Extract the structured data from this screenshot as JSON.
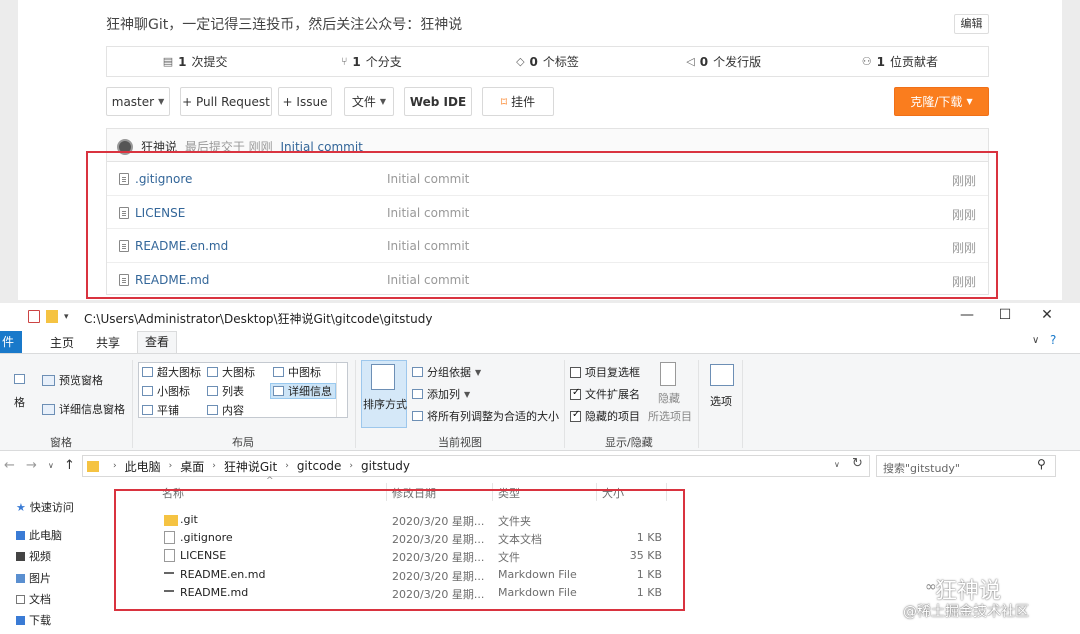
{
  "repo": {
    "description": "狂神聊Git，一定记得三连投币，然后关注公众号：狂神说",
    "edit_label": "编辑",
    "stats": [
      {
        "icon": "commit-icon",
        "count": "1",
        "label": "次提交"
      },
      {
        "icon": "branch-icon",
        "count": "1",
        "label": "个分支"
      },
      {
        "icon": "tag-icon",
        "count": "0",
        "label": "个标签"
      },
      {
        "icon": "release-icon",
        "count": "0",
        "label": "个发行版"
      },
      {
        "icon": "contributor-icon",
        "count": "1",
        "label": "位贡献者"
      }
    ],
    "toolbar": {
      "branch": "master",
      "pull_request": "+ Pull Request",
      "issue": "+ Issue",
      "file": "文件",
      "web_ide": "Web IDE",
      "star": "挂件",
      "clone": "克隆/下载"
    },
    "last_commit": {
      "author": "狂神说",
      "meta": "最后提交于 刚刚",
      "message": "Initial commit"
    },
    "files": [
      {
        "name": ".gitignore",
        "message": "Initial commit",
        "time": "刚刚"
      },
      {
        "name": "LICENSE",
        "message": "Initial commit",
        "time": "刚刚"
      },
      {
        "name": "README.en.md",
        "message": "Initial commit",
        "time": "刚刚"
      },
      {
        "name": "README.md",
        "message": "Initial commit",
        "time": "刚刚"
      }
    ]
  },
  "explorer": {
    "title_path": "C:\\Users\\Administrator\\Desktop\\狂神说Git\\gitcode\\gitstudy",
    "qa_arrow": "▾",
    "win_controls": {
      "minimize": "—",
      "maximize": "☐",
      "close": "✕"
    },
    "ribbon_tabs": {
      "file": "件",
      "home": "主页",
      "share": "共享",
      "view": "查看"
    },
    "ribbon_collapse": "∨",
    "help": "?",
    "ribbon": {
      "pane": {
        "preview": "预览窗格",
        "details": "详细信息窗格",
        "nav_partial": "格",
        "label": "窗格"
      },
      "layout": {
        "xl_icons": "超大图标",
        "l_icons": "大图标",
        "m_icons": "中图标",
        "s_icons": "小图标",
        "list": "列表",
        "details": "详细信息",
        "tiles": "平铺",
        "content": "内容",
        "label": "布局"
      },
      "current_view": {
        "sort": "排序方式",
        "group": "分组依据",
        "add_col": "添加列",
        "fit_cols": "将所有列调整为合适的大小",
        "label": "当前视图"
      },
      "show_hide": {
        "item_checkbox": "项目复选框",
        "file_ext": "文件扩展名",
        "hidden_items": "隐藏的项目",
        "hide": "隐藏",
        "hide_selected": "所选项目",
        "label": "显示/隐藏"
      },
      "options": "选项"
    },
    "nav": {
      "back": "←",
      "forward": "→",
      "recent": "∨",
      "up": "↑"
    },
    "breadcrumb": [
      "此电脑",
      "桌面",
      "狂神说Git",
      "gitcode",
      "gitstudy"
    ],
    "address_dropdown": "∨",
    "refresh": "↻",
    "search_placeholder": "搜索\"gitstudy\"",
    "search_icon": "⚲",
    "nav_pane": [
      {
        "icon": "star-icon",
        "label": "快速访问"
      },
      {
        "icon": "computer-icon",
        "label": "此电脑"
      },
      {
        "icon": "video-icon",
        "label": "视频"
      },
      {
        "icon": "picture-icon",
        "label": "图片"
      },
      {
        "icon": "document-icon",
        "label": "文档"
      },
      {
        "icon": "download-icon",
        "label": "下载"
      }
    ],
    "columns": {
      "name": "名称",
      "date": "修改日期",
      "type": "类型",
      "size": "大小"
    },
    "sort_caret": "^",
    "rows": [
      {
        "icon": "folder-icon",
        "name": ".git",
        "date": "2020/3/20 星期...",
        "type": "文件夹",
        "size": ""
      },
      {
        "icon": "text-file-icon",
        "name": ".gitignore",
        "date": "2020/3/20 星期...",
        "type": "文本文档",
        "size": "1 KB"
      },
      {
        "icon": "file-icon",
        "name": "LICENSE",
        "date": "2020/3/20 星期...",
        "type": "文件",
        "size": "35 KB"
      },
      {
        "icon": "markdown-file-icon",
        "name": "README.en.md",
        "date": "2020/3/20 星期...",
        "type": "Markdown File",
        "size": "1 KB"
      },
      {
        "icon": "markdown-file-icon",
        "name": "README.md",
        "date": "2020/3/20 星期...",
        "type": "Markdown File",
        "size": "1 KB"
      }
    ]
  },
  "watermark": {
    "logo": "∞",
    "top": "狂神说",
    "bottom": "@稀土掘金技术社区"
  },
  "colors": {
    "accent_orange": "#fa7d1e",
    "highlight_red": "#d9333f",
    "link_blue": "#336699",
    "win_blue": "#1979ca"
  }
}
